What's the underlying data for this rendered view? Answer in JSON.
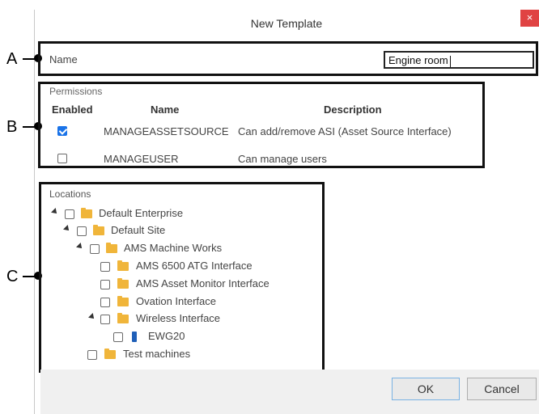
{
  "dialog": {
    "title": "New Template",
    "close_label": "×"
  },
  "callouts": {
    "a": "A",
    "b": "B",
    "c": "C"
  },
  "name_section": {
    "label": "Name",
    "value": "Engine room"
  },
  "permissions": {
    "group_label": "Permissions",
    "headers": {
      "enabled": "Enabled",
      "name": "Name",
      "description": "Description"
    },
    "rows": [
      {
        "enabled": true,
        "name": "MANAGEASSETSOURCE",
        "description": "Can add/remove ASI (Asset Source Interface)"
      },
      {
        "enabled": false,
        "name": "MANAGEUSER",
        "description": "Can manage users"
      }
    ]
  },
  "locations": {
    "group_label": "Locations",
    "tree": [
      {
        "label": "Default Enterprise",
        "icon": "folder-icon",
        "expanded": true
      },
      {
        "label": "Default Site",
        "icon": "folder-icon",
        "expanded": true
      },
      {
        "label": "AMS Machine Works",
        "icon": "folder-icon",
        "expanded": true
      },
      {
        "label": "AMS 6500 ATG Interface",
        "icon": "folder-icon"
      },
      {
        "label": "AMS Asset Monitor Interface",
        "icon": "folder-icon"
      },
      {
        "label": "Ovation Interface",
        "icon": "folder-icon"
      },
      {
        "label": "Wireless Interface",
        "icon": "folder-icon",
        "expanded": true
      },
      {
        "label": "EWG20",
        "icon": "device-icon"
      },
      {
        "label": "Test machines",
        "icon": "folder-open-icon"
      }
    ]
  },
  "footer": {
    "ok_label": "OK",
    "cancel_label": "Cancel"
  },
  "colors": {
    "close_button": "#e04343",
    "checkbox_checked": "#1a73e8",
    "folder": "#f0b53a",
    "device": "#1f5fb8"
  }
}
